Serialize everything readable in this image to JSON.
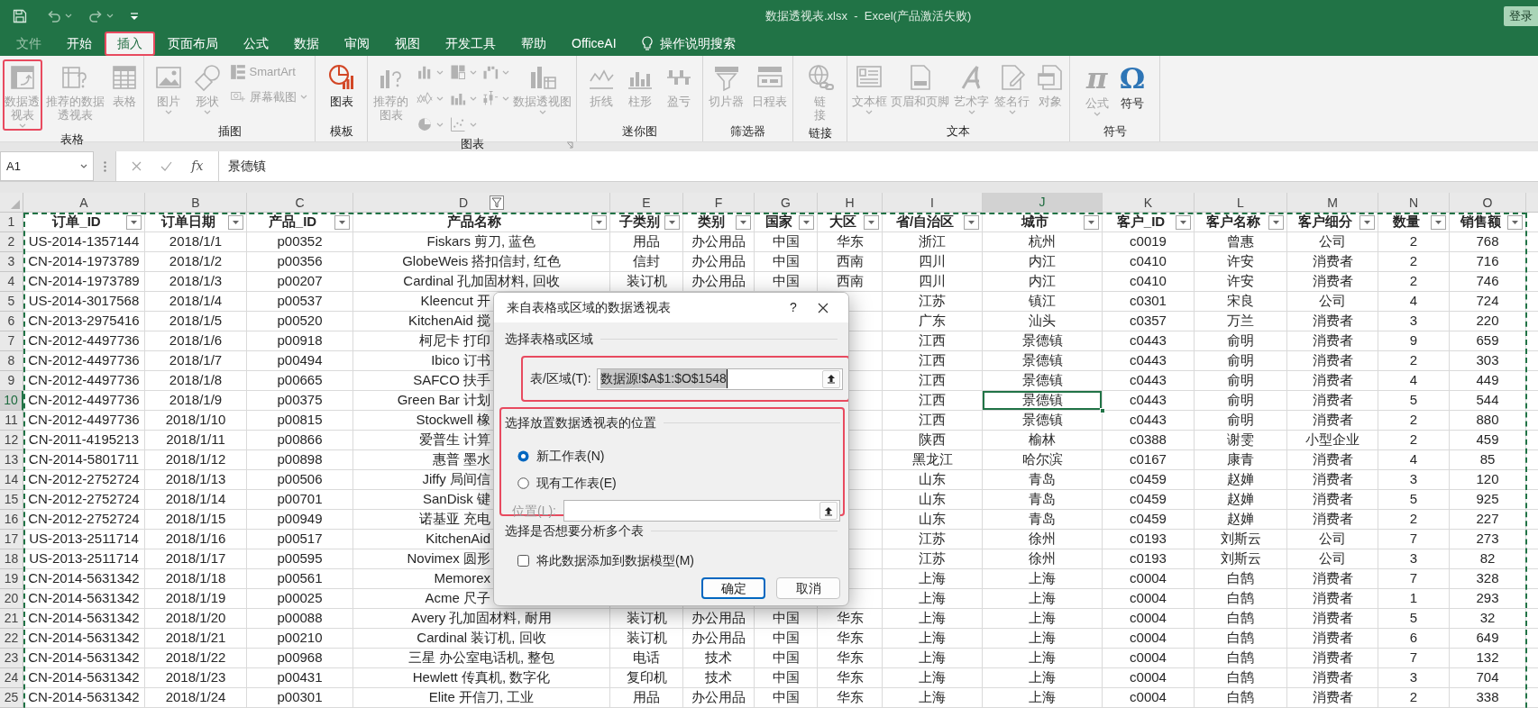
{
  "title_bar": {
    "title": "数据透视表.xlsx  -  Excel(产品激活失败)",
    "login": "登录"
  },
  "tabs": [
    {
      "label": "文件",
      "selected": false,
      "disabled": true,
      "highlighted": false
    },
    {
      "label": "开始",
      "selected": false,
      "disabled": false,
      "highlighted": false
    },
    {
      "label": "插入",
      "selected": true,
      "disabled": false,
      "highlighted": true
    },
    {
      "label": "页面布局",
      "selected": false,
      "disabled": false,
      "highlighted": false
    },
    {
      "label": "公式",
      "selected": false,
      "disabled": false,
      "highlighted": false
    },
    {
      "label": "数据",
      "selected": false,
      "disabled": false,
      "highlighted": false
    },
    {
      "label": "审阅",
      "selected": false,
      "disabled": false,
      "highlighted": false
    },
    {
      "label": "视图",
      "selected": false,
      "disabled": false,
      "highlighted": false
    },
    {
      "label": "开发工具",
      "selected": false,
      "disabled": false,
      "highlighted": false
    },
    {
      "label": "帮助",
      "selected": false,
      "disabled": false,
      "highlighted": false
    },
    {
      "label": "OfficeAI",
      "selected": false,
      "disabled": false,
      "highlighted": false
    }
  ],
  "tell_me": "操作说明搜索",
  "ribbon": {
    "groups": [
      {
        "label": "表格",
        "launcher": false,
        "items": [
          {
            "kind": "large",
            "label": "数据透视表",
            "disabled": true,
            "dropdown": true,
            "highlighted": true
          },
          {
            "kind": "large",
            "label": "推荐的数据透视表",
            "disabled": true,
            "dropdown": false,
            "highlighted": false
          },
          {
            "kind": "large",
            "label": "表格",
            "disabled": true,
            "dropdown": false,
            "highlighted": false
          }
        ]
      },
      {
        "label": "插图",
        "launcher": false,
        "items": [
          {
            "kind": "large",
            "label": "图片",
            "disabled": true,
            "dropdown": true,
            "highlighted": false
          },
          {
            "kind": "large",
            "label": "形状",
            "disabled": true,
            "dropdown": true,
            "highlighted": false
          },
          {
            "kind": "small",
            "label": "SmartArt",
            "disabled": true,
            "dropdown": false,
            "highlighted": false
          },
          {
            "kind": "small",
            "label": "屏幕截图",
            "disabled": true,
            "dropdown": true,
            "highlighted": false
          }
        ]
      },
      {
        "label": "模板",
        "launcher": false,
        "items": [
          {
            "kind": "large",
            "label": "图表",
            "disabled": false,
            "dropdown": false,
            "highlighted": false
          }
        ]
      },
      {
        "label": "图表",
        "launcher": true,
        "items": [
          {
            "kind": "large",
            "label": "推荐的图表",
            "disabled": true,
            "dropdown": false,
            "highlighted": false
          },
          {
            "kind": "icon",
            "disabled": true,
            "dropdown": true,
            "highlighted": false
          },
          {
            "kind": "icon",
            "disabled": true,
            "dropdown": true,
            "highlighted": false
          },
          {
            "kind": "icon",
            "disabled": true,
            "dropdown": true,
            "highlighted": false
          },
          {
            "kind": "icon",
            "disabled": true,
            "dropdown": true,
            "highlighted": false
          },
          {
            "kind": "icon",
            "disabled": true,
            "dropdown": true,
            "highlighted": false
          },
          {
            "kind": "icon",
            "disabled": true,
            "dropdown": true,
            "highlighted": false
          },
          {
            "kind": "icon",
            "disabled": true,
            "dropdown": true,
            "highlighted": false
          },
          {
            "kind": "icon",
            "disabled": true,
            "dropdown": true,
            "highlighted": false
          },
          {
            "kind": "large",
            "label": "数据透视图",
            "disabled": true,
            "dropdown": true,
            "highlighted": false
          }
        ]
      },
      {
        "label": "迷你图",
        "launcher": false,
        "items": [
          {
            "kind": "large",
            "label": "折线",
            "disabled": true,
            "dropdown": false,
            "highlighted": false
          },
          {
            "kind": "large",
            "label": "柱形",
            "disabled": true,
            "dropdown": false,
            "highlighted": false
          },
          {
            "kind": "large",
            "label": "盈亏",
            "disabled": true,
            "dropdown": false,
            "highlighted": false
          }
        ]
      },
      {
        "label": "筛选器",
        "launcher": false,
        "items": [
          {
            "kind": "large",
            "label": "切片器",
            "disabled": true,
            "dropdown": false,
            "highlighted": false
          },
          {
            "kind": "large",
            "label": "日程表",
            "disabled": true,
            "dropdown": false,
            "highlighted": false
          }
        ]
      },
      {
        "label": "链接",
        "launcher": false,
        "items": [
          {
            "kind": "large",
            "label": "链接",
            "disabled": true,
            "dropdown": false,
            "highlighted": false
          }
        ]
      },
      {
        "label": "文本",
        "launcher": false,
        "items": [
          {
            "kind": "large",
            "label": "文本框",
            "disabled": true,
            "dropdown": true,
            "highlighted": false
          },
          {
            "kind": "large",
            "label": "页眉和页脚",
            "disabled": true,
            "dropdown": false,
            "highlighted": false
          },
          {
            "kind": "large",
            "label": "艺术字",
            "disabled": true,
            "dropdown": true,
            "highlighted": false
          },
          {
            "kind": "large",
            "label": "签名行",
            "disabled": true,
            "dropdown": true,
            "highlighted": false
          },
          {
            "kind": "large",
            "label": "对象",
            "disabled": true,
            "dropdown": false,
            "highlighted": false
          }
        ]
      },
      {
        "label": "符号",
        "launcher": false,
        "items": [
          {
            "kind": "large",
            "glyph": "π",
            "label": "公式",
            "disabled": true,
            "dropdown": true,
            "highlighted": false
          },
          {
            "kind": "large",
            "glyph": "Ω",
            "label": "符号",
            "disabled": false,
            "dropdown": false,
            "highlighted": false
          }
        ]
      }
    ]
  },
  "formula_bar": {
    "name_box": "A1",
    "function_label": "fx",
    "formula": "景德镇"
  },
  "sheet": {
    "columns": [
      {
        "letter": "A",
        "selected": false,
        "filtered": false
      },
      {
        "letter": "B",
        "selected": false,
        "filtered": false
      },
      {
        "letter": "C",
        "selected": false,
        "filtered": false
      },
      {
        "letter": "D",
        "selected": false,
        "filtered": true
      },
      {
        "letter": "E",
        "selected": false,
        "filtered": false
      },
      {
        "letter": "F",
        "selected": false,
        "filtered": false
      },
      {
        "letter": "G",
        "selected": false,
        "filtered": false
      },
      {
        "letter": "H",
        "selected": false,
        "filtered": false
      },
      {
        "letter": "I",
        "selected": false,
        "filtered": false
      },
      {
        "letter": "J",
        "selected": true,
        "filtered": false
      },
      {
        "letter": "K",
        "selected": false,
        "filtered": false
      },
      {
        "letter": "L",
        "selected": false,
        "filtered": false
      },
      {
        "letter": "M",
        "selected": false,
        "filtered": false
      },
      {
        "letter": "N",
        "selected": false,
        "filtered": false
      },
      {
        "letter": "O",
        "selected": false,
        "filtered": false
      }
    ],
    "header_row": {
      "number": "1",
      "cells": [
        "订单_ID",
        "订单日期",
        "产品_ID",
        "产品名称",
        "子类别",
        "类别",
        "国家",
        "大区",
        "省/自治区",
        "城市",
        "客户_ID",
        "客户名称",
        "客户细分",
        "数量",
        "销售额"
      ]
    },
    "rows": [
      {
        "number": "2",
        "selected": false,
        "cells": [
          "US-2014-1357144",
          "2018/1/1",
          "p00352",
          "Fiskars 剪刀, 蓝色",
          "用品",
          "办公用品",
          "中国",
          "华东",
          "浙江",
          "杭州",
          "c0019",
          "曾惠",
          "公司",
          "2",
          "768"
        ]
      },
      {
        "number": "3",
        "selected": false,
        "cells": [
          "CN-2014-1973789",
          "2018/1/2",
          "p00356",
          "GlobeWeis 搭扣信封, 红色",
          "信封",
          "办公用品",
          "中国",
          "西南",
          "四川",
          "内江",
          "c0410",
          "许安",
          "消费者",
          "2",
          "716"
        ]
      },
      {
        "number": "4",
        "selected": false,
        "cells": [
          "CN-2014-1973789",
          "2018/1/3",
          "p00207",
          "Cardinal 孔加固材料, 回收",
          "装订机",
          "办公用品",
          "中国",
          "西南",
          "四川",
          "内江",
          "c0410",
          "许安",
          "消费者",
          "2",
          "746"
        ]
      },
      {
        "number": "5",
        "selected": false,
        "cells": [
          "US-2014-3017568",
          "2018/1/4",
          "p00537",
          "Kleencut 开",
          null,
          null,
          null,
          null,
          "江苏",
          "镇江",
          "c0301",
          "宋良",
          "公司",
          "4",
          "724"
        ]
      },
      {
        "number": "6",
        "selected": false,
        "cells": [
          "CN-2013-2975416",
          "2018/1/5",
          "p00520",
          "KitchenAid 搅",
          null,
          null,
          null,
          null,
          "广东",
          "汕头",
          "c0357",
          "万兰",
          "消费者",
          "3",
          "220"
        ]
      },
      {
        "number": "7",
        "selected": false,
        "cells": [
          "CN-2012-4497736",
          "2018/1/6",
          "p00918",
          "柯尼卡 打印",
          null,
          null,
          null,
          null,
          "江西",
          "景德镇",
          "c0443",
          "俞明",
          "消费者",
          "9",
          "659"
        ]
      },
      {
        "number": "8",
        "selected": false,
        "cells": [
          "CN-2012-4497736",
          "2018/1/7",
          "p00494",
          "Ibico 订书",
          null,
          null,
          null,
          null,
          "江西",
          "景德镇",
          "c0443",
          "俞明",
          "消费者",
          "2",
          "303"
        ]
      },
      {
        "number": "9",
        "selected": false,
        "cells": [
          "CN-2012-4497736",
          "2018/1/8",
          "p00665",
          "SAFCO 扶手",
          null,
          null,
          null,
          null,
          "江西",
          "景德镇",
          "c0443",
          "俞明",
          "消费者",
          "4",
          "449"
        ]
      },
      {
        "number": "10",
        "selected": true,
        "cells": [
          "CN-2012-4497736",
          "2018/1/9",
          "p00375",
          "Green Bar 计划",
          null,
          null,
          null,
          null,
          "江西",
          "景德镇",
          "c0443",
          "俞明",
          "消费者",
          "5",
          "544"
        ]
      },
      {
        "number": "11",
        "selected": false,
        "cells": [
          "CN-2012-4497736",
          "2018/1/10",
          "p00815",
          "Stockwell 橡",
          null,
          null,
          null,
          null,
          "江西",
          "景德镇",
          "c0443",
          "俞明",
          "消费者",
          "2",
          "880"
        ]
      },
      {
        "number": "12",
        "selected": false,
        "cells": [
          "CN-2011-4195213",
          "2018/1/11",
          "p00866",
          "爱普生 计算",
          null,
          null,
          null,
          null,
          "陕西",
          "榆林",
          "c0388",
          "谢雯",
          "小型企业",
          "2",
          "459"
        ]
      },
      {
        "number": "13",
        "selected": false,
        "cells": [
          "CN-2014-5801711",
          "2018/1/12",
          "p00898",
          "惠普 墨水",
          null,
          null,
          null,
          null,
          "黑龙江",
          "哈尔滨",
          "c0167",
          "康青",
          "消费者",
          "4",
          "85"
        ]
      },
      {
        "number": "14",
        "selected": false,
        "cells": [
          "CN-2012-2752724",
          "2018/1/13",
          "p00506",
          "Jiffy 局间信",
          null,
          null,
          null,
          null,
          "山东",
          "青岛",
          "c0459",
          "赵婵",
          "消费者",
          "3",
          "120"
        ]
      },
      {
        "number": "15",
        "selected": false,
        "cells": [
          "CN-2012-2752724",
          "2018/1/14",
          "p00701",
          "SanDisk 键",
          null,
          null,
          null,
          null,
          "山东",
          "青岛",
          "c0459",
          "赵婵",
          "消费者",
          "5",
          "925"
        ]
      },
      {
        "number": "16",
        "selected": false,
        "cells": [
          "CN-2012-2752724",
          "2018/1/15",
          "p00949",
          "诺基亚 充电",
          null,
          null,
          null,
          null,
          "山东",
          "青岛",
          "c0459",
          "赵婵",
          "消费者",
          "2",
          "227"
        ]
      },
      {
        "number": "17",
        "selected": false,
        "cells": [
          "US-2013-2511714",
          "2018/1/16",
          "p00517",
          "KitchenAid",
          null,
          null,
          null,
          null,
          "江苏",
          "徐州",
          "c0193",
          "刘斯云",
          "公司",
          "7",
          "273"
        ]
      },
      {
        "number": "18",
        "selected": false,
        "cells": [
          "US-2013-2511714",
          "2018/1/17",
          "p00595",
          "Novimex 圆形",
          null,
          null,
          null,
          null,
          "江苏",
          "徐州",
          "c0193",
          "刘斯云",
          "公司",
          "3",
          "82"
        ]
      },
      {
        "number": "19",
        "selected": false,
        "cells": [
          "CN-2014-5631342",
          "2018/1/18",
          "p00561",
          "Memorex",
          null,
          null,
          null,
          null,
          "上海",
          "上海",
          "c0004",
          "白鹄",
          "消费者",
          "7",
          "328"
        ]
      },
      {
        "number": "20",
        "selected": false,
        "cells": [
          "CN-2014-5631342",
          "2018/1/19",
          "p00025",
          "Acme 尺子",
          null,
          null,
          null,
          null,
          "上海",
          "上海",
          "c0004",
          "白鹄",
          "消费者",
          "1",
          "293"
        ]
      },
      {
        "number": "21",
        "selected": false,
        "cells": [
          "CN-2014-5631342",
          "2018/1/20",
          "p00088",
          "Avery 孔加固材料, 耐用",
          "装订机",
          "办公用品",
          "中国",
          "华东",
          "上海",
          "上海",
          "c0004",
          "白鹄",
          "消费者",
          "5",
          "32"
        ]
      },
      {
        "number": "22",
        "selected": false,
        "cells": [
          "CN-2014-5631342",
          "2018/1/21",
          "p00210",
          "Cardinal 装订机, 回收",
          "装订机",
          "办公用品",
          "中国",
          "华东",
          "上海",
          "上海",
          "c0004",
          "白鹄",
          "消费者",
          "6",
          "649"
        ]
      },
      {
        "number": "23",
        "selected": false,
        "cells": [
          "CN-2014-5631342",
          "2018/1/22",
          "p00968",
          "三星 办公室电话机, 整包",
          "电话",
          "技术",
          "中国",
          "华东",
          "上海",
          "上海",
          "c0004",
          "白鹄",
          "消费者",
          "7",
          "132"
        ]
      },
      {
        "number": "24",
        "selected": false,
        "cells": [
          "CN-2014-5631342",
          "2018/1/23",
          "p00431",
          "Hewlett 传真机, 数字化",
          "复印机",
          "技术",
          "中国",
          "华东",
          "上海",
          "上海",
          "c0004",
          "白鹄",
          "消费者",
          "3",
          "704"
        ]
      },
      {
        "number": "25",
        "selected": false,
        "cells": [
          "CN-2014-5631342",
          "2018/1/24",
          "p00301",
          "Elite 开信刀, 工业",
          "用品",
          "办公用品",
          "中国",
          "华东",
          "上海",
          "上海",
          "c0004",
          "白鹄",
          "消费者",
          "2",
          "338"
        ]
      }
    ]
  },
  "dialog": {
    "title": "来自表格或区域的数据透视表",
    "help": "?",
    "source": {
      "heading": "选择表格或区域",
      "label": "表/区域(T):",
      "value": "数据源!$A$1:$O$1548",
      "value_selected": true,
      "highlighted": true
    },
    "placement": {
      "heading": "选择放置数据透视表的位置",
      "highlighted": true,
      "options": [
        {
          "label": "新工作表(N)",
          "selected": true
        },
        {
          "label": "现有工作表(E)",
          "selected": false
        }
      ],
      "location": {
        "label": "位置(L):",
        "disabled": true
      }
    },
    "multiple": {
      "heading": "选择是否想要分析多个表",
      "checkbox": {
        "label": "将此数据添加到数据模型(M)",
        "checked": false
      }
    },
    "buttons": [
      {
        "label": "确定",
        "default": true
      },
      {
        "label": "取消",
        "default": false
      }
    ]
  }
}
